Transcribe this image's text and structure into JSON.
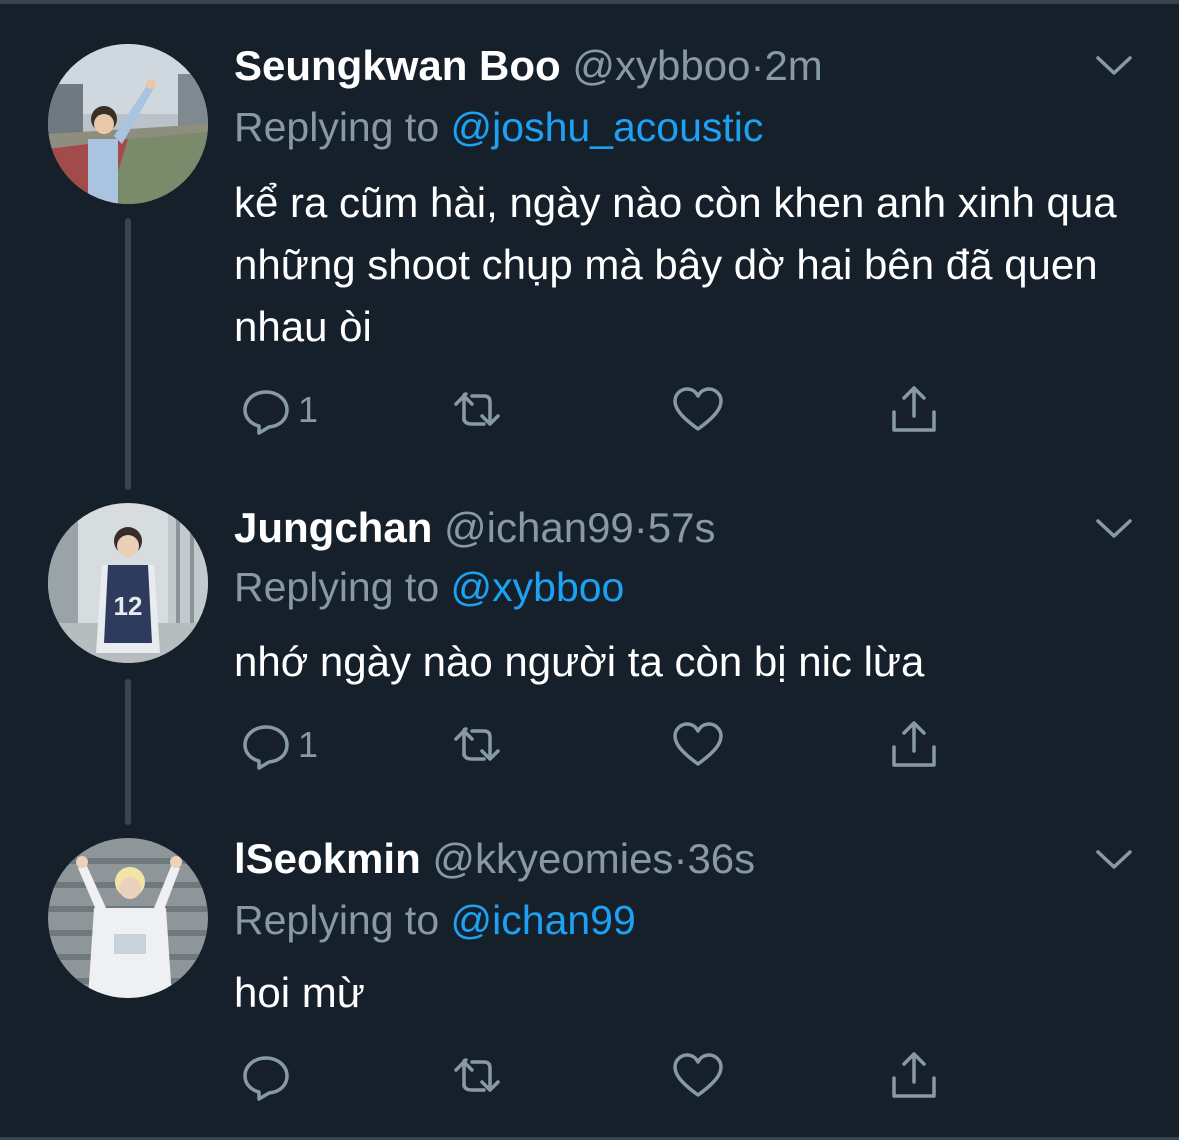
{
  "colors": {
    "background": "#15202b",
    "text_primary": "#ffffff",
    "text_secondary": "#8899a6",
    "link": "#1da1f2",
    "divider": "#38444d"
  },
  "tweets": [
    {
      "display_name": "Seungkwan Boo",
      "handle": "@xybboo",
      "separator": "·",
      "time": "2m",
      "replying_label": "Replying to",
      "replying_to": "@joshu_acoustic",
      "text": "kể ra cũm hài, ngày nào còn khen anh xinh qua những shoot chụp mà bây dờ hai bên đã quen nhau òi",
      "reply_count": "1",
      "icons": [
        "chevron-down-icon",
        "reply-icon",
        "retweet-icon",
        "like-icon",
        "share-icon"
      ]
    },
    {
      "display_name": "Jungchan",
      "handle": "@ichan99",
      "separator": "·",
      "time": "57s",
      "replying_label": "Replying to",
      "replying_to": "@xybboo",
      "text": "nhớ ngày nào người ta còn bị nic lừa",
      "reply_count": "1",
      "icons": [
        "chevron-down-icon",
        "reply-icon",
        "retweet-icon",
        "like-icon",
        "share-icon"
      ]
    },
    {
      "display_name": "lSeokmin",
      "handle": "@kkyeomies",
      "separator": "·",
      "time": "36s",
      "replying_label": "Replying to",
      "replying_to": "@ichan99",
      "text": "hoi mừ",
      "reply_count": "",
      "icons": [
        "chevron-down-icon",
        "reply-icon",
        "retweet-icon",
        "like-icon",
        "share-icon"
      ]
    }
  ]
}
